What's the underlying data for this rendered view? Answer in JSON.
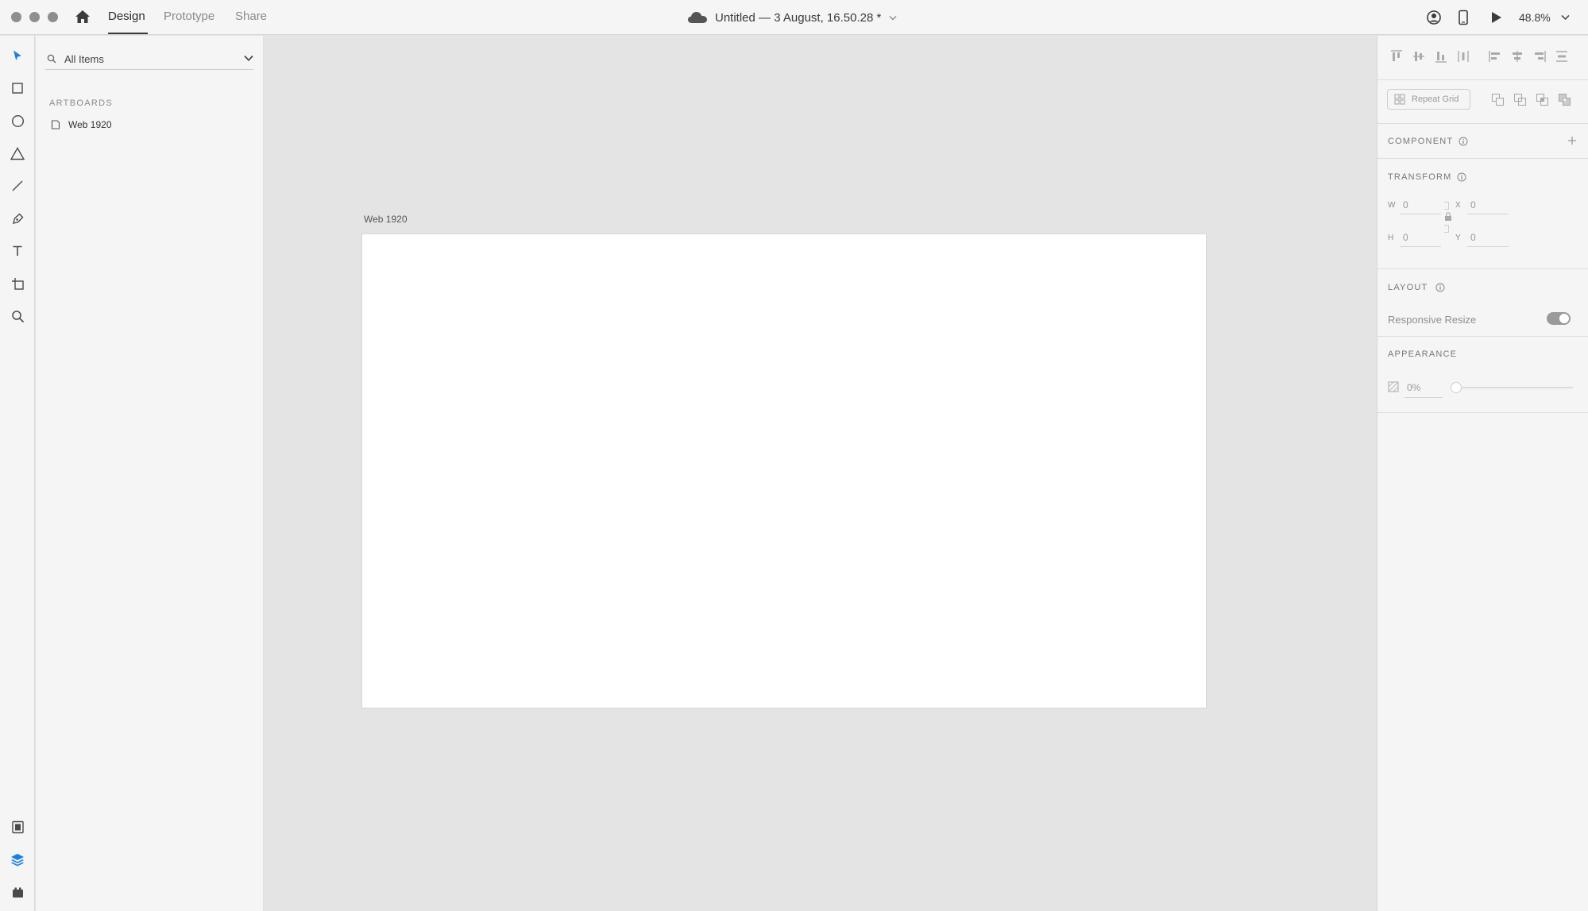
{
  "window": {
    "traffic_lights": [
      "close",
      "minimize",
      "zoom"
    ]
  },
  "titlebar": {
    "tabs": [
      {
        "label": "Design",
        "active": true
      },
      {
        "label": "Prototype",
        "active": false
      },
      {
        "label": "Share",
        "active": false
      }
    ],
    "document_title": "Untitled — 3 August, 16.50.28 *",
    "zoom": "48.8%",
    "icons": [
      "home-icon",
      "cloud-icon",
      "user-icon",
      "mobile-preview-icon",
      "play-icon"
    ]
  },
  "toolbar": {
    "tools": [
      "select-tool",
      "rectangle-tool",
      "ellipse-tool",
      "polygon-tool",
      "line-tool",
      "pen-tool",
      "text-tool",
      "artboard-tool",
      "zoom-tool"
    ],
    "bottom": [
      "assets-icon",
      "layers-icon",
      "plugins-icon"
    ],
    "accent": "#1a7fe0"
  },
  "layers": {
    "search_label": "All Items",
    "section": "ARTBOARDS",
    "items": [
      {
        "label": "Web 1920"
      }
    ]
  },
  "canvas": {
    "artboard_title": "Web 1920"
  },
  "inspector": {
    "repeat_grid": "Repeat Grid",
    "component_label": "COMPONENT",
    "transform_label": "TRANSFORM",
    "fields": {
      "w_label": "W",
      "w_value": "0",
      "h_label": "H",
      "h_value": "0",
      "x_label": "X",
      "x_value": "0",
      "y_label": "Y",
      "y_value": "0"
    },
    "layout_label": "LAYOUT",
    "responsive_resize": "Responsive Resize",
    "responsive_resize_on": true,
    "appearance_label": "APPEARANCE",
    "opacity": "0%"
  }
}
